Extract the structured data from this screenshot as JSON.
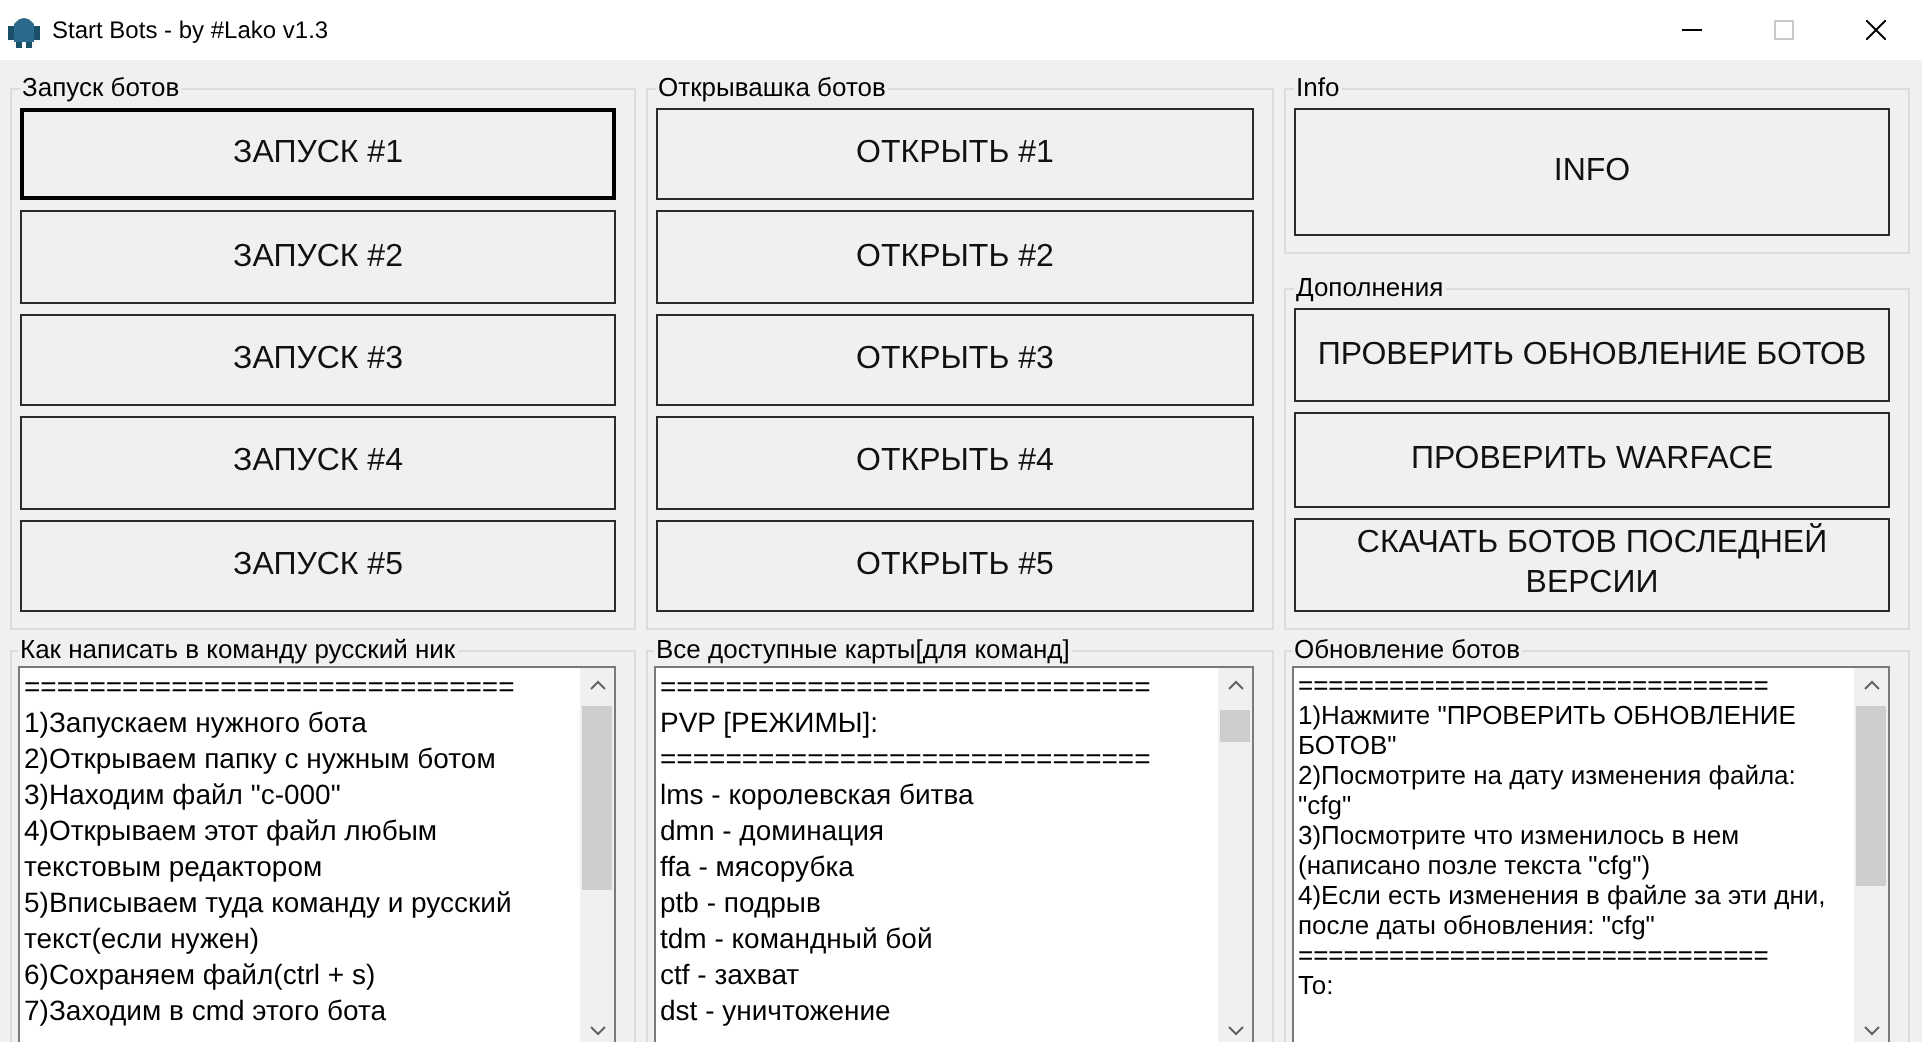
{
  "window": {
    "title": "Start Bots - by #Lako v1.3",
    "controls": [
      {
        "kind": "minimize",
        "disabled": false
      },
      {
        "kind": "maximize",
        "disabled": true
      },
      {
        "kind": "close",
        "disabled": false
      }
    ]
  },
  "columns": [
    {
      "groups": [
        {
          "label": "Запуск ботов",
          "buttons": [
            {
              "label": "ЗАПУСК #1",
              "focused": true
            },
            {
              "label": "ЗАПУСК #2",
              "focused": false
            },
            {
              "label": "ЗАПУСК #3",
              "focused": false
            },
            {
              "label": "ЗАПУСК #4",
              "focused": false
            },
            {
              "label": "ЗАПУСК #5",
              "focused": false
            }
          ]
        }
      ]
    },
    {
      "groups": [
        {
          "label": "Открывашка ботов",
          "buttons": [
            {
              "label": "ОТКРЫТЬ #1",
              "focused": false
            },
            {
              "label": "ОТКРЫТЬ #2",
              "focused": false
            },
            {
              "label": "ОТКРЫТЬ #3",
              "focused": false
            },
            {
              "label": "ОТКРЫТЬ #4",
              "focused": false
            },
            {
              "label": "ОТКРЫТЬ #5",
              "focused": false
            }
          ]
        }
      ]
    },
    {
      "groups": [
        {
          "label": "Info",
          "buttons": [
            {
              "label": "INFO",
              "focused": false
            }
          ]
        },
        {
          "label": "Дополнения",
          "buttons": [
            {
              "label": "ПРОВЕРИТЬ ОБНОВЛЕНИЕ БОТОВ",
              "focused": false
            },
            {
              "label": "ПРОВЕРИТЬ WARFACE",
              "focused": false
            },
            {
              "label": "СКАЧАТЬ БОТОВ ПОСЛЕДНЕЙ ВЕРСИИ",
              "focused": false
            }
          ]
        }
      ]
    }
  ],
  "text_panels": [
    {
      "label": "Как написать в команду русский ник",
      "lines": [
        "==============================",
        "1)Запускаем нужного бота",
        "2)Открываем папку с нужным ботом",
        "3)Находим файл \"c-000\"",
        "4)Открываем этот файл любым текстовым редактором",
        "5)Вписываем туда команду и русский текст(если нужен)",
        "6)Сохраняем файл(ctrl + s)",
        "7)Заходим в cmd этого бота"
      ]
    },
    {
      "label": "Все доступные карты[для команд]",
      "lines": [
        "==============================",
        "PVP [РЕЖИМЫ]:",
        "==============================",
        "lms - королевская битва",
        "dmn - доминация",
        "ffa - мясорубка",
        "ptb - подрыв",
        "tdm - командный бой",
        "ctf - захват",
        "dst - уничтожение"
      ]
    },
    {
      "label": "Обновление ботов",
      "lines": [
        "===============================",
        "1)Нажмите \"ПРОВЕРИТЬ ОБНОВЛЕНИЕ БОТОВ\"",
        "2)Посмотрите на дату изменения файла: \"cfg\"",
        "3)Посмотрите что изменилось в нем (написано позле текста \"cfg\")",
        "4)Если есть изменения в файле за эти дни, после даты обновления: \"cfg\"",
        "===============================",
        "То:"
      ]
    }
  ]
}
